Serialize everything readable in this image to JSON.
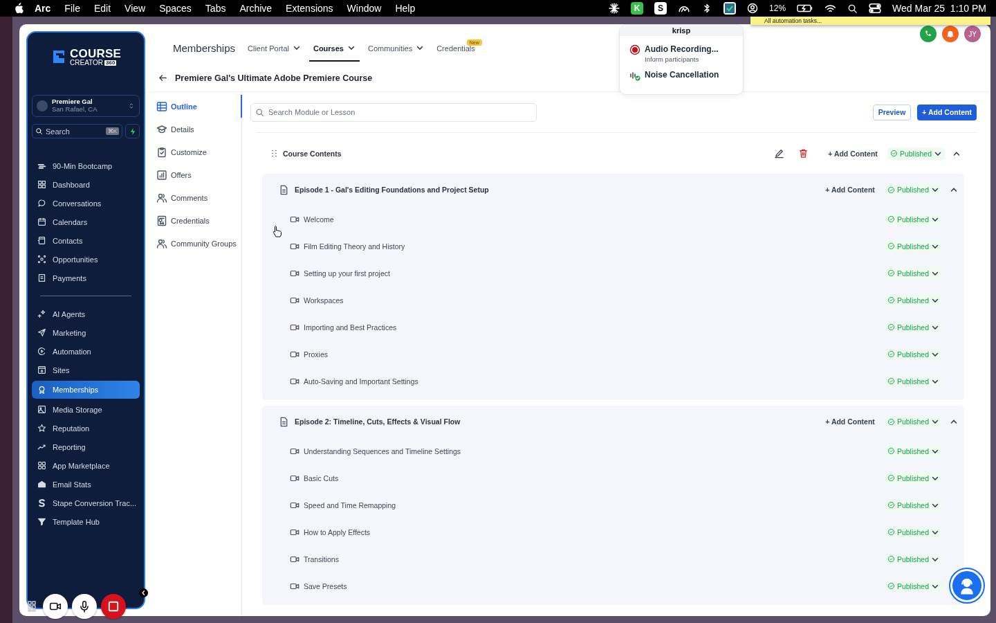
{
  "menubar": {
    "app": "Arc",
    "menus": [
      "File",
      "Edit",
      "View",
      "Spaces",
      "Tabs",
      "Archive",
      "Extensions",
      "Window",
      "Help"
    ],
    "app_badges": [
      "K",
      "S"
    ],
    "battery": "12%",
    "datetime": "Wed Mar 25  1:10 PM"
  },
  "tooltip": "All automation tasks...",
  "krisp": {
    "title": "krisp",
    "items": [
      {
        "kind": "recording",
        "title": "Audio Recording...",
        "subtitle": "Inform participants"
      },
      {
        "kind": "noise",
        "title": "Noise Cancellation"
      }
    ]
  },
  "sidebar": {
    "logo": {
      "line1": "COURSE",
      "line2": "CREATOR",
      "badge": "360"
    },
    "account": {
      "name": "Premiere Gal",
      "location": "San Rafael, CA"
    },
    "search": {
      "placeholder": "Search",
      "shortcut": "⌘K"
    },
    "groups": [
      [
        {
          "label": "90-Min Bootcamp",
          "selected": false
        },
        {
          "label": "Dashboard",
          "selected": false
        },
        {
          "label": "Conversations",
          "selected": false
        },
        {
          "label": "Calendars",
          "selected": false
        },
        {
          "label": "Contacts",
          "selected": false
        },
        {
          "label": "Opportunities",
          "selected": false
        },
        {
          "label": "Payments",
          "selected": false
        }
      ],
      [
        {
          "label": "AI Agents",
          "selected": false
        },
        {
          "label": "Marketing",
          "selected": false
        },
        {
          "label": "Automation",
          "selected": false
        },
        {
          "label": "Sites",
          "selected": false
        },
        {
          "label": "Memberships",
          "selected": true
        },
        {
          "label": "Media Storage",
          "selected": false
        },
        {
          "label": "Reputation",
          "selected": false
        },
        {
          "label": "Reporting",
          "selected": false
        },
        {
          "label": "App Marketplace",
          "selected": false
        },
        {
          "label": "Email Stats",
          "selected": false
        },
        {
          "label": "Stape Conversion Trac...",
          "selected": false
        },
        {
          "label": "Template Hub",
          "selected": false
        }
      ]
    ]
  },
  "topnav": {
    "title": "Memberships",
    "tabs": [
      {
        "label": "Client Portal",
        "dropdown": true,
        "selected": false
      },
      {
        "label": "Courses",
        "dropdown": true,
        "selected": true
      },
      {
        "label": "Communities",
        "dropdown": true,
        "selected": false
      },
      {
        "label": "Credentials",
        "selected": false,
        "badge": "New"
      }
    ]
  },
  "user": {
    "initials": "JY"
  },
  "course": {
    "title": "Premiere Gal's Ultimate Adobe Premiere Course",
    "subnav": [
      {
        "label": "Outline",
        "selected": true
      },
      {
        "label": "Details",
        "selected": false
      },
      {
        "label": "Customize",
        "selected": false
      },
      {
        "label": "Offers",
        "selected": false
      },
      {
        "label": "Comments",
        "selected": false
      },
      {
        "label": "Credentials",
        "selected": false
      },
      {
        "label": "Community Groups",
        "selected": false
      }
    ],
    "search": {
      "placeholder": "Search Module or Lesson"
    },
    "preview": "Preview",
    "add": "+ Add Content",
    "contents": {
      "title": "Course Contents",
      "add": "+ Add Content",
      "status": "Published",
      "expanded": true
    },
    "episodes": [
      {
        "title": "Episode 1 - Gal's Editing Foundations and Project Setup",
        "add": "+ Add Content",
        "status": "Published",
        "expanded": true,
        "lessons": [
          {
            "title": "Welcome",
            "status": "Published"
          },
          {
            "title": "Film Editing Theory and History",
            "status": "Published"
          },
          {
            "title": "Setting up your first project",
            "status": "Published"
          },
          {
            "title": "Workspaces",
            "status": "Published"
          },
          {
            "title": "Importing and Best Practices",
            "status": "Published"
          },
          {
            "title": "Proxies",
            "status": "Published"
          },
          {
            "title": "Auto-Saving and Important Settings",
            "status": "Published"
          }
        ]
      },
      {
        "title": "Episode 2: Timeline, Cuts, Effects & Visual Flow",
        "add": "+ Add Content",
        "status": "Published",
        "expanded": true,
        "lessons": [
          {
            "title": "Understanding Sequences and Timeline Settings",
            "status": "Published"
          },
          {
            "title": "Basic Cuts",
            "status": "Published"
          },
          {
            "title": "Speed and Time Remapping",
            "status": "Published"
          },
          {
            "title": "How to Apply Effects",
            "status": "Published"
          },
          {
            "title": "Transitions",
            "status": "Published"
          },
          {
            "title": "Save Presets",
            "status": "Published"
          }
        ]
      }
    ]
  }
}
